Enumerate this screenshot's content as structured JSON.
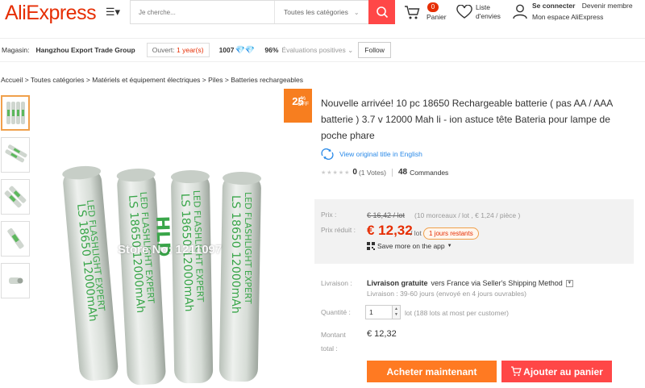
{
  "header": {
    "logo": "AliExpress",
    "search_placeholder": "Je cherche...",
    "category": "Toutes les catégories",
    "cart_count": "0",
    "cart_label": "Panier",
    "wishlist_line1": "Liste",
    "wishlist_line2": "d'envies",
    "signin": "Se connecter",
    "join": "Devenir membre",
    "account": "Mon espace AliExpress"
  },
  "store": {
    "label": "Magasin:",
    "name": "Hangzhou Export Trade Group",
    "open_prefix": "Ouvert:",
    "open_years": "1 year(s)",
    "points": "1007",
    "feedback_pct": "96%",
    "feedback_label": "Évaluations positives",
    "follow": "Follow"
  },
  "breadcrumb": "Accueil > Toutes catégories > Matériels et équipement électriques > Piles > Batteries rechargeables",
  "product": {
    "discount": "25",
    "discount_suffix": "%",
    "discount_off": "OFF",
    "title": "Nouvelle arrivée! 10 pc 18650 Rechargeable batterie ( pas AA / AAA batterie ) 3.7 v 12000 Mah li - ion astuce tête Bateria pour lampe de poche phare",
    "translate_link": "View original title in English",
    "rating": "0",
    "votes": "(1 Votes)",
    "orders": "48",
    "orders_label": "Commandes",
    "watermark": "Store No: 1211097",
    "battery_brand": "HLD",
    "battery_line1": "LED FLASHLIGHT EXPERT",
    "battery_line2": "LS 18650 12000mAh"
  },
  "pricing": {
    "price_label": "Prix :",
    "old_price": "€ 16,42 / lot",
    "old_note": "(10 morceaux / lot , € 1,24 / pièce )",
    "reduced_label": "Prix réduit :",
    "new_price": "€ 12,32",
    "per_lot": "/ lot",
    "days_left": "1 jours restants",
    "app_save": "Save more on the app"
  },
  "shipping": {
    "label": "Livraison :",
    "free": "Livraison gratuite",
    "rest": "vers  France via Seller's Shipping Method",
    "sub": "Livraison : 39-60 jours (envoyé en 4 jours ouvrables)"
  },
  "quantity": {
    "label": "Quantité :",
    "value": "1",
    "note": "lot (188 lots at most per customer)"
  },
  "total": {
    "label": "Montant total :",
    "value": "€ 12,32"
  },
  "actions": {
    "buy": "Acheter maintenant",
    "add_cart": "Ajouter au panier"
  }
}
